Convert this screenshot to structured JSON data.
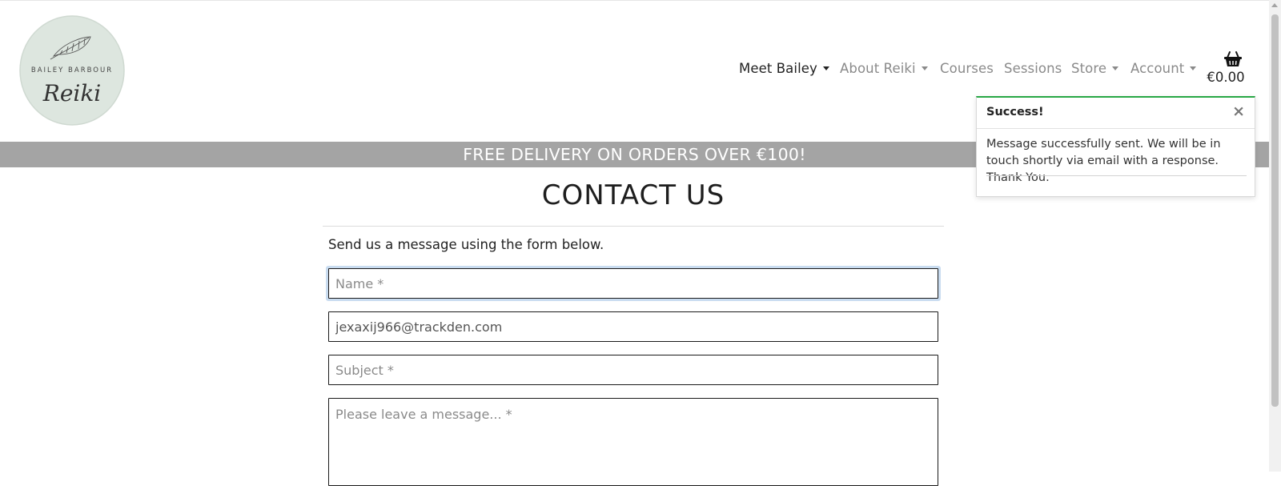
{
  "logo": {
    "line1": "BAILEY BARBOUR",
    "line2": "Reiki"
  },
  "nav": {
    "items": [
      {
        "label": "Meet Bailey",
        "dropdown": true,
        "active": true
      },
      {
        "label": "About Reiki",
        "dropdown": true,
        "active": false
      },
      {
        "label": "Courses",
        "dropdown": false,
        "active": false
      },
      {
        "label": "Sessions",
        "dropdown": false,
        "active": false
      },
      {
        "label": "Store",
        "dropdown": true,
        "active": false
      },
      {
        "label": "Account",
        "dropdown": true,
        "active": false
      }
    ],
    "cart_icon": "basket-icon",
    "cart_total": "€0.00"
  },
  "banner": {
    "text": "FREE DELIVERY ON ORDERS OVER €100!"
  },
  "contact": {
    "title": "CONTACT US",
    "intro": "Send us a message using the form below.",
    "name_placeholder": "Name *",
    "email_value": "jexaxij966@trackden.com",
    "subject_placeholder": "Subject *",
    "message_placeholder": "Please leave a message... *"
  },
  "toast": {
    "title": "Success!",
    "close": "×",
    "message": "Message successfully sent. We will be in touch shortly via email with a response. Thank You."
  },
  "colors": {
    "banner": "#a4a4a4",
    "success_accent": "#28a745",
    "logo_bg": "#dde6df"
  }
}
